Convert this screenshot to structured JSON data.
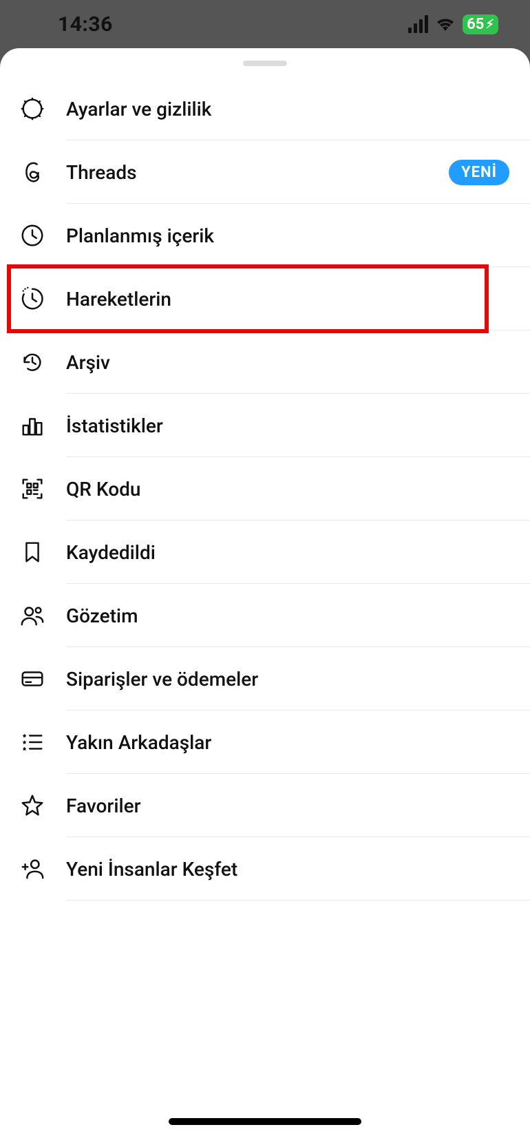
{
  "status_bar": {
    "time": "14:36",
    "battery_percent": "65"
  },
  "menu": {
    "items": [
      {
        "id": "settings",
        "label": "Ayarlar ve gizlilik",
        "icon": "gear",
        "badge": null
      },
      {
        "id": "threads",
        "label": "Threads",
        "icon": "threads",
        "badge": "YENİ"
      },
      {
        "id": "scheduled",
        "label": "Planlanmış içerik",
        "icon": "clock",
        "badge": null
      },
      {
        "id": "activity",
        "label": "Hareketlerin",
        "icon": "activity-clock",
        "badge": null
      },
      {
        "id": "archive",
        "label": "Arşiv",
        "icon": "history",
        "badge": null
      },
      {
        "id": "insights",
        "label": "İstatistikler",
        "icon": "bar-chart",
        "badge": null
      },
      {
        "id": "qr",
        "label": "QR Kodu",
        "icon": "qr",
        "badge": null
      },
      {
        "id": "saved",
        "label": "Kaydedildi",
        "icon": "bookmark",
        "badge": null
      },
      {
        "id": "supervision",
        "label": "Gözetim",
        "icon": "people",
        "badge": null
      },
      {
        "id": "orders",
        "label": "Siparişler ve ödemeler",
        "icon": "card",
        "badge": null
      },
      {
        "id": "close-friends",
        "label": "Yakın Arkadaşlar",
        "icon": "star-list",
        "badge": null
      },
      {
        "id": "favorites",
        "label": "Favoriler",
        "icon": "star",
        "badge": null
      },
      {
        "id": "discover",
        "label": "Yeni İnsanlar Keşfet",
        "icon": "person-add",
        "badge": null
      }
    ]
  },
  "highlight": {
    "item_index": 3
  },
  "colors": {
    "badge_bg": "#219cff",
    "highlight_border": "#e80606",
    "battery_bg": "#30c24c",
    "separator": "#e9e9e9"
  }
}
